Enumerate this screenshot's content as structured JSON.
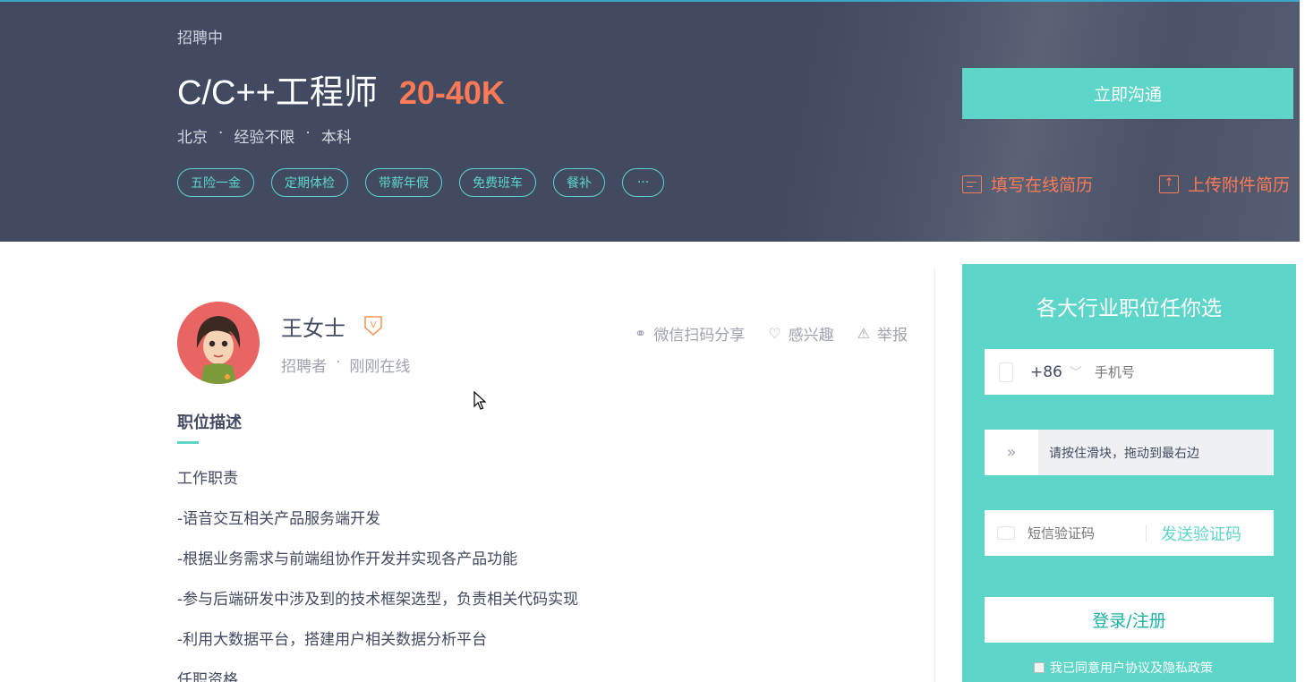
{
  "header": {
    "status": "招聘中",
    "job_title": "C/C++工程师",
    "salary": "20-40K",
    "meta": [
      "北京",
      "经验不限",
      "本科"
    ],
    "meta_separator": "·",
    "tags": [
      "五险一金",
      "定期体检",
      "带薪年假",
      "免费班车",
      "餐补"
    ],
    "more_tag": "···",
    "chat_button": "立即沟通",
    "online_resume": "填写在线简历",
    "upload_resume": "上传附件简历",
    "upload_glyph": "↑"
  },
  "recruiter": {
    "name": "王女士",
    "badge": "V",
    "role": "招聘者",
    "separator": "·",
    "online_status": "刚刚在线"
  },
  "actions": {
    "share": "微信扫码分享",
    "interest": "感兴趣",
    "report": "举报",
    "share_glyph": "⚭",
    "interest_glyph": "♡",
    "report_glyph": "⚠"
  },
  "description": {
    "title": "职位描述",
    "lines": [
      "工作职责",
      "-语音交互相关产品服务端开发",
      "-根据业务需求与前端组协作开发并实现各产品功能",
      "-参与后端研发中涉及到的技术框架选型，负责相关代码实现",
      "-利用大数据平台，搭建用户相关数据分析平台",
      "任职资格"
    ]
  },
  "login": {
    "title": "各大行业职位任你选",
    "country_code": "+86",
    "chevron": "﹀",
    "phone_placeholder": "手机号",
    "slider_handle": "»",
    "slider_hint": "请按住滑块，拖动到最右边",
    "sms_placeholder": "短信验证码",
    "send_code": "发送验证码",
    "login_button": "登录/注册",
    "agreement": "我已同意用户协议及隐私政策"
  },
  "colors": {
    "banner": "#414a60",
    "accent": "#5dd5c8",
    "salary": "#fe7a56"
  }
}
